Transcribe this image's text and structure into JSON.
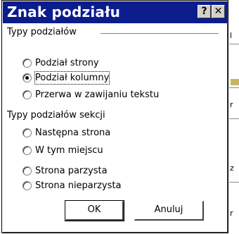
{
  "window": {
    "title": "Znak podziału",
    "help_label": "?",
    "close_label": "✕"
  },
  "groups": {
    "break_types_label": "Typy podziałów",
    "section_types_label": "Typy podziałów sekcji"
  },
  "break_types": [
    {
      "label": "Podział strony",
      "selected": false
    },
    {
      "label": "Podział kolumny",
      "selected": true
    },
    {
      "label": "Przerwa w zawijaniu tekstu",
      "selected": false
    }
  ],
  "section_types": [
    {
      "label": "Następna strona",
      "selected": false
    },
    {
      "label": "W tym miejscu",
      "selected": false
    },
    {
      "label": "Strona parzysta",
      "selected": false
    },
    {
      "label": "Strona nieparzysta",
      "selected": false
    }
  ],
  "buttons": {
    "ok_label": "OK",
    "cancel_label": "Anuluj"
  },
  "background": {
    "fragments": [
      "l",
      "r",
      "z",
      "r"
    ]
  },
  "colors": {
    "titlebar": "#0b1d8c",
    "dialog_bg": "#ffffff"
  }
}
